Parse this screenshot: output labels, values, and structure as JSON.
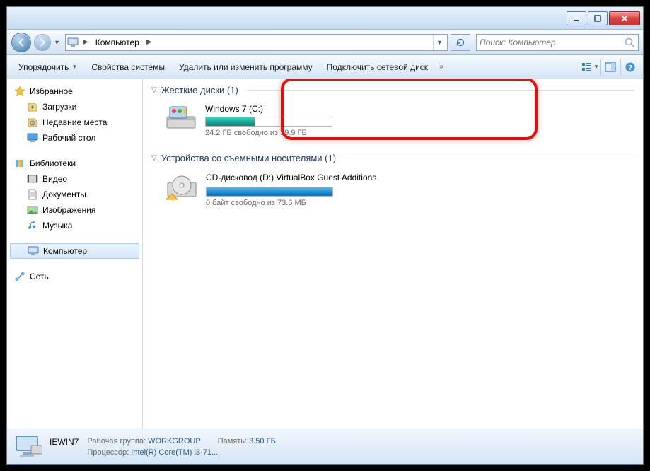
{
  "titlebar": {},
  "nav": {
    "location": "Компьютер",
    "search_placeholder": "Поиск: Компьютер"
  },
  "toolbar": {
    "organize": "Упорядочить",
    "system_props": "Свойства системы",
    "uninstall": "Удалить или изменить программу",
    "map_drive": "Подключить сетевой диск"
  },
  "sidebar": {
    "favorites": {
      "label": "Избранное",
      "items": [
        {
          "label": "Загрузки"
        },
        {
          "label": "Недавние места"
        },
        {
          "label": "Рабочий стол"
        }
      ]
    },
    "libraries": {
      "label": "Библиотеки",
      "items": [
        {
          "label": "Видео"
        },
        {
          "label": "Документы"
        },
        {
          "label": "Изображения"
        },
        {
          "label": "Музыка"
        }
      ]
    },
    "computer": {
      "label": "Компьютер"
    },
    "network": {
      "label": "Сеть"
    }
  },
  "content": {
    "hdd": {
      "title": "Жесткие диски (1)",
      "drives": [
        {
          "name": "Windows 7 (C:)",
          "info": "24.2 ГБ свободно из 39.9 ГБ",
          "fill_pct": 39
        }
      ]
    },
    "removable": {
      "title": "Устройства со съемными носителями (1)",
      "drives": [
        {
          "name": "CD-дисковод (D:) VirtualBox Guest Additions",
          "info": "0 байт свободно из 73.6 МБ"
        }
      ]
    }
  },
  "status": {
    "computer_name": "IEWIN7",
    "workgroup_key": "Рабочая группа:",
    "workgroup_val": "WORKGROUP",
    "memory_key": "Память:",
    "memory_val": "3.50 ГБ",
    "cpu_key": "Процессор:",
    "cpu_val": "Intel(R) Core(TM) i3-71..."
  }
}
